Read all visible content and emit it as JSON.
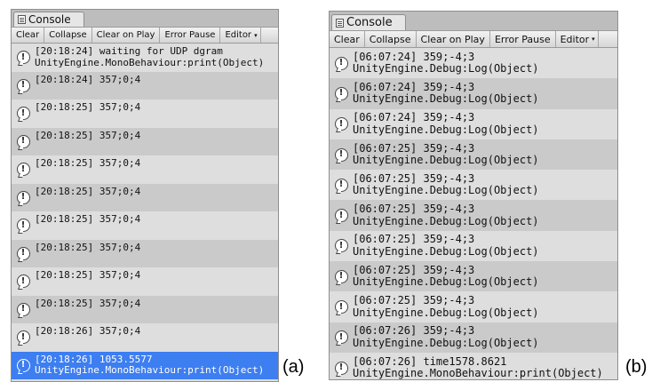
{
  "panels": [
    {
      "tab_label": "Console",
      "toolbar": [
        "Clear",
        "Collapse",
        "Clear on Play",
        "Error Pause",
        "Editor"
      ],
      "toolbar_dropdown_glyph": "▾",
      "entries": [
        {
          "line1": "[20:18:24] waiting for UDP dgram",
          "line2": "UnityEngine.MonoBehaviour:print(Object)"
        },
        {
          "line1": "[20:18:24] 357;0;4",
          "line2": ""
        },
        {
          "line1": "[20:18:25] 357;0;4",
          "line2": ""
        },
        {
          "line1": "[20:18:25] 357;0;4",
          "line2": ""
        },
        {
          "line1": "[20:18:25] 357;0;4",
          "line2": ""
        },
        {
          "line1": "[20:18:25] 357;0;4",
          "line2": ""
        },
        {
          "line1": "[20:18:25] 357;0;4",
          "line2": ""
        },
        {
          "line1": "[20:18:25] 357;0;4",
          "line2": ""
        },
        {
          "line1": "[20:18:25] 357;0;4",
          "line2": ""
        },
        {
          "line1": "[20:18:25] 357;0;4",
          "line2": ""
        },
        {
          "line1": "[20:18:26] 357;0;4",
          "line2": ""
        },
        {
          "line1": "[20:18:26] 1053.5577",
          "line2": "UnityEngine.MonoBehaviour:print(Object)",
          "selected": true
        }
      ],
      "caption": "(a)"
    },
    {
      "tab_label": "Console",
      "toolbar": [
        "Clear",
        "Collapse",
        "Clear on Play",
        "Error Pause",
        "Editor"
      ],
      "toolbar_dropdown_glyph": "▾",
      "entries": [
        {
          "line1": "[06:07:24] 359;-4;3",
          "line2": "UnityEngine.Debug:Log(Object)"
        },
        {
          "line1": "[06:07:24] 359;-4;3",
          "line2": "UnityEngine.Debug:Log(Object)"
        },
        {
          "line1": "[06:07:24] 359;-4;3",
          "line2": "UnityEngine.Debug:Log(Object)"
        },
        {
          "line1": "[06:07:25] 359;-4;3",
          "line2": "UnityEngine.Debug:Log(Object)"
        },
        {
          "line1": "[06:07:25] 359;-4;3",
          "line2": "UnityEngine.Debug:Log(Object)"
        },
        {
          "line1": "[06:07:25] 359;-4;3",
          "line2": "UnityEngine.Debug:Log(Object)"
        },
        {
          "line1": "[06:07:25] 359;-4;3",
          "line2": "UnityEngine.Debug:Log(Object)"
        },
        {
          "line1": "[06:07:25] 359;-4;3",
          "line2": "UnityEngine.Debug:Log(Object)"
        },
        {
          "line1": "[06:07:25] 359;-4;3",
          "line2": "UnityEngine.Debug:Log(Object)"
        },
        {
          "line1": "[06:07:26] 359;-4;3",
          "line2": "UnityEngine.Debug:Log(Object)"
        },
        {
          "line1": "[06:07:26] time1578.8621",
          "line2": "UnityEngine.MonoBehaviour:print(Object)"
        }
      ],
      "caption": "(b)"
    }
  ],
  "icons": {
    "tab": "console-window-icon",
    "entry": "log-message-icon",
    "entry_glyph": "!"
  },
  "colors": {
    "selected_row": "#3d7ef1",
    "row_alt": "#cacaca",
    "row_base": "#dedede"
  }
}
